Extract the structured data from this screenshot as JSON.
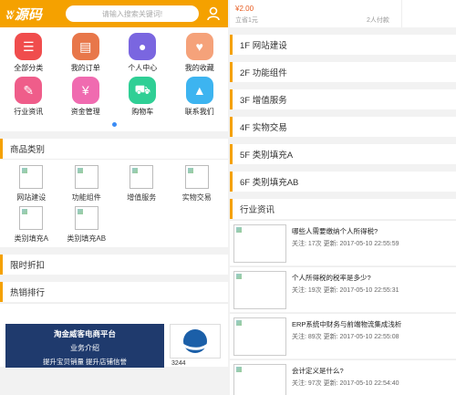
{
  "header": {
    "logo": "ʬ源码",
    "search_placeholder": "请输入搜索关键词!",
    "user_icon": "user-icon"
  },
  "icons": [
    {
      "label": "全部分类",
      "color": "#f04d4d",
      "icon": "list-icon",
      "glyph": "☰"
    },
    {
      "label": "我的订单",
      "color": "#e8774a",
      "icon": "order-icon",
      "glyph": "▤"
    },
    {
      "label": "个人中心",
      "color": "#7a66e0",
      "icon": "person-icon",
      "glyph": "●"
    },
    {
      "label": "我的收藏",
      "color": "#f5a27a",
      "icon": "heart-icon",
      "glyph": "♥"
    },
    {
      "label": "行业资讯",
      "color": "#ef5d8a",
      "icon": "pencil-icon",
      "glyph": "✎"
    },
    {
      "label": "资金管理",
      "color": "#f06bb0",
      "icon": "yen-icon",
      "glyph": "¥"
    },
    {
      "label": "购物车",
      "color": "#2fcf95",
      "icon": "cart-icon",
      "glyph": "⛟"
    },
    {
      "label": "联系我们",
      "color": "#3db4f0",
      "icon": "graduation-icon",
      "glyph": "▲"
    }
  ],
  "sections": {
    "categories": "商品类别",
    "flash_sale": "限时折扣",
    "hot_rank": "热销排行",
    "news": "行业资讯"
  },
  "categories": [
    {
      "label": "网站建设"
    },
    {
      "label": "功能组件"
    },
    {
      "label": "增值服务"
    },
    {
      "label": "实物交易"
    },
    {
      "label": "类别填充A"
    },
    {
      "label": "类别填充AB"
    }
  ],
  "hot": {
    "banner_title": "淘金威客电商平台",
    "banner_sub": "业务介绍",
    "banner_line": "提升宝贝销量    提升店铺信誉",
    "logo_number": "3244"
  },
  "top_card": {
    "price": "¥2.00",
    "price_sub": "立省1元",
    "paid": "2人付款"
  },
  "floors": [
    {
      "label": "1F 网站建设"
    },
    {
      "label": "2F 功能组件"
    },
    {
      "label": "3F 增值服务"
    },
    {
      "label": "4F 实物交易"
    },
    {
      "label": "5F 类别填充A"
    },
    {
      "label": "6F 类别填充AB"
    }
  ],
  "news": [
    {
      "title": "哪些人需要缴纳个人所得税?",
      "meta": "关注: 17次    更新: 2017-05-10 22:55:59"
    },
    {
      "title": "个人所得税的税率是多少?",
      "meta": "关注: 19次    更新: 2017-05-10 22:55:31"
    },
    {
      "title": "ERP系统中财务与前端物流集成浅析",
      "meta": "关注: 89次    更新: 2017-05-10 22:55:08"
    },
    {
      "title": "会计定义是什么?",
      "meta": "关注: 97次    更新: 2017-05-10 22:54:40"
    }
  ]
}
